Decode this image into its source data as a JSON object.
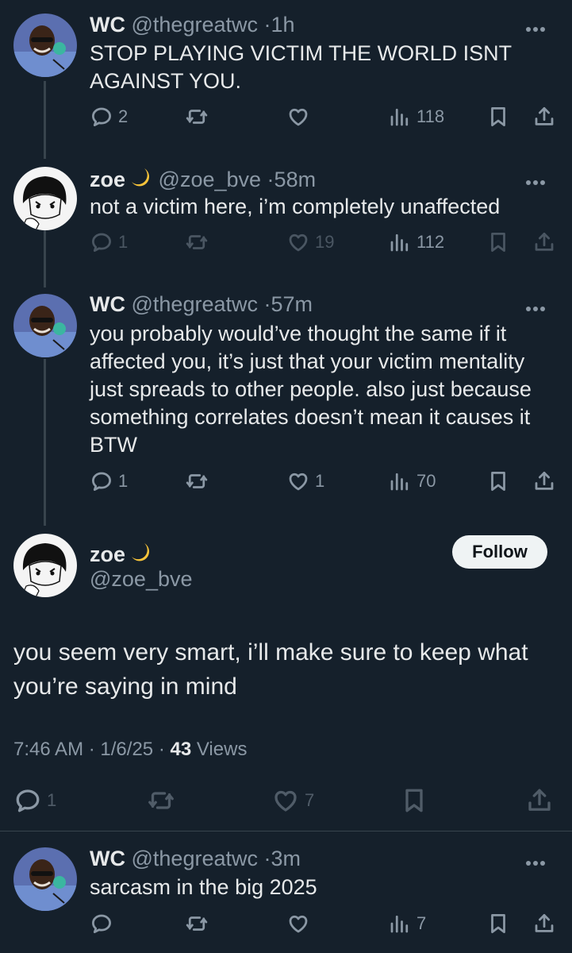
{
  "tweets": [
    {
      "name": "WC",
      "handle": "@thegreatwc",
      "time": "1h",
      "text": "STOP PLAYING VICTIM THE WORLD ISNT AGAINST YOU.",
      "replies": "2",
      "retweets": "",
      "likes": "",
      "views": "118"
    },
    {
      "name": "zoe",
      "handle": "@zoe_bve",
      "time": "58m",
      "text": "not a victim here, i’m completely unaffected",
      "replies": "1",
      "retweets": "",
      "likes": "19",
      "views": "112"
    },
    {
      "name": "WC",
      "handle": "@thegreatwc",
      "time": "57m",
      "text": "you probably would’ve thought the same if it affected you, it’s just that your victim mentality just spreads to other people. also just because something correlates doesn’t mean it causes it BTW",
      "replies": "1",
      "retweets": "",
      "likes": "1",
      "views": "70"
    }
  ],
  "focused": {
    "name": "zoe",
    "handle": "@zoe_bve",
    "follow_label": "Follow",
    "text": "you seem very smart, i’ll make sure to keep what you’re saying in mind",
    "time": "7:46 AM",
    "date": "1/6/25",
    "views_count": "43",
    "views_label": "Views",
    "replies": "1",
    "retweets": "",
    "likes": "7"
  },
  "reply": {
    "name": "WC",
    "handle": "@thegreatwc",
    "time": "3m",
    "text": "sarcasm in the big 2025",
    "replies": "",
    "retweets": "",
    "likes": "",
    "views": "7"
  },
  "separator": "·",
  "icons": [
    "reply-icon",
    "retweet-icon",
    "like-icon",
    "views-icon",
    "bookmark-icon",
    "share-icon",
    "more-icon",
    "moon-emoji"
  ],
  "colors": {
    "background": "#15202b",
    "text": "#e7e9ea",
    "secondary": "#8b98a5",
    "line": "#38444d",
    "follow_bg": "#eff3f4"
  }
}
